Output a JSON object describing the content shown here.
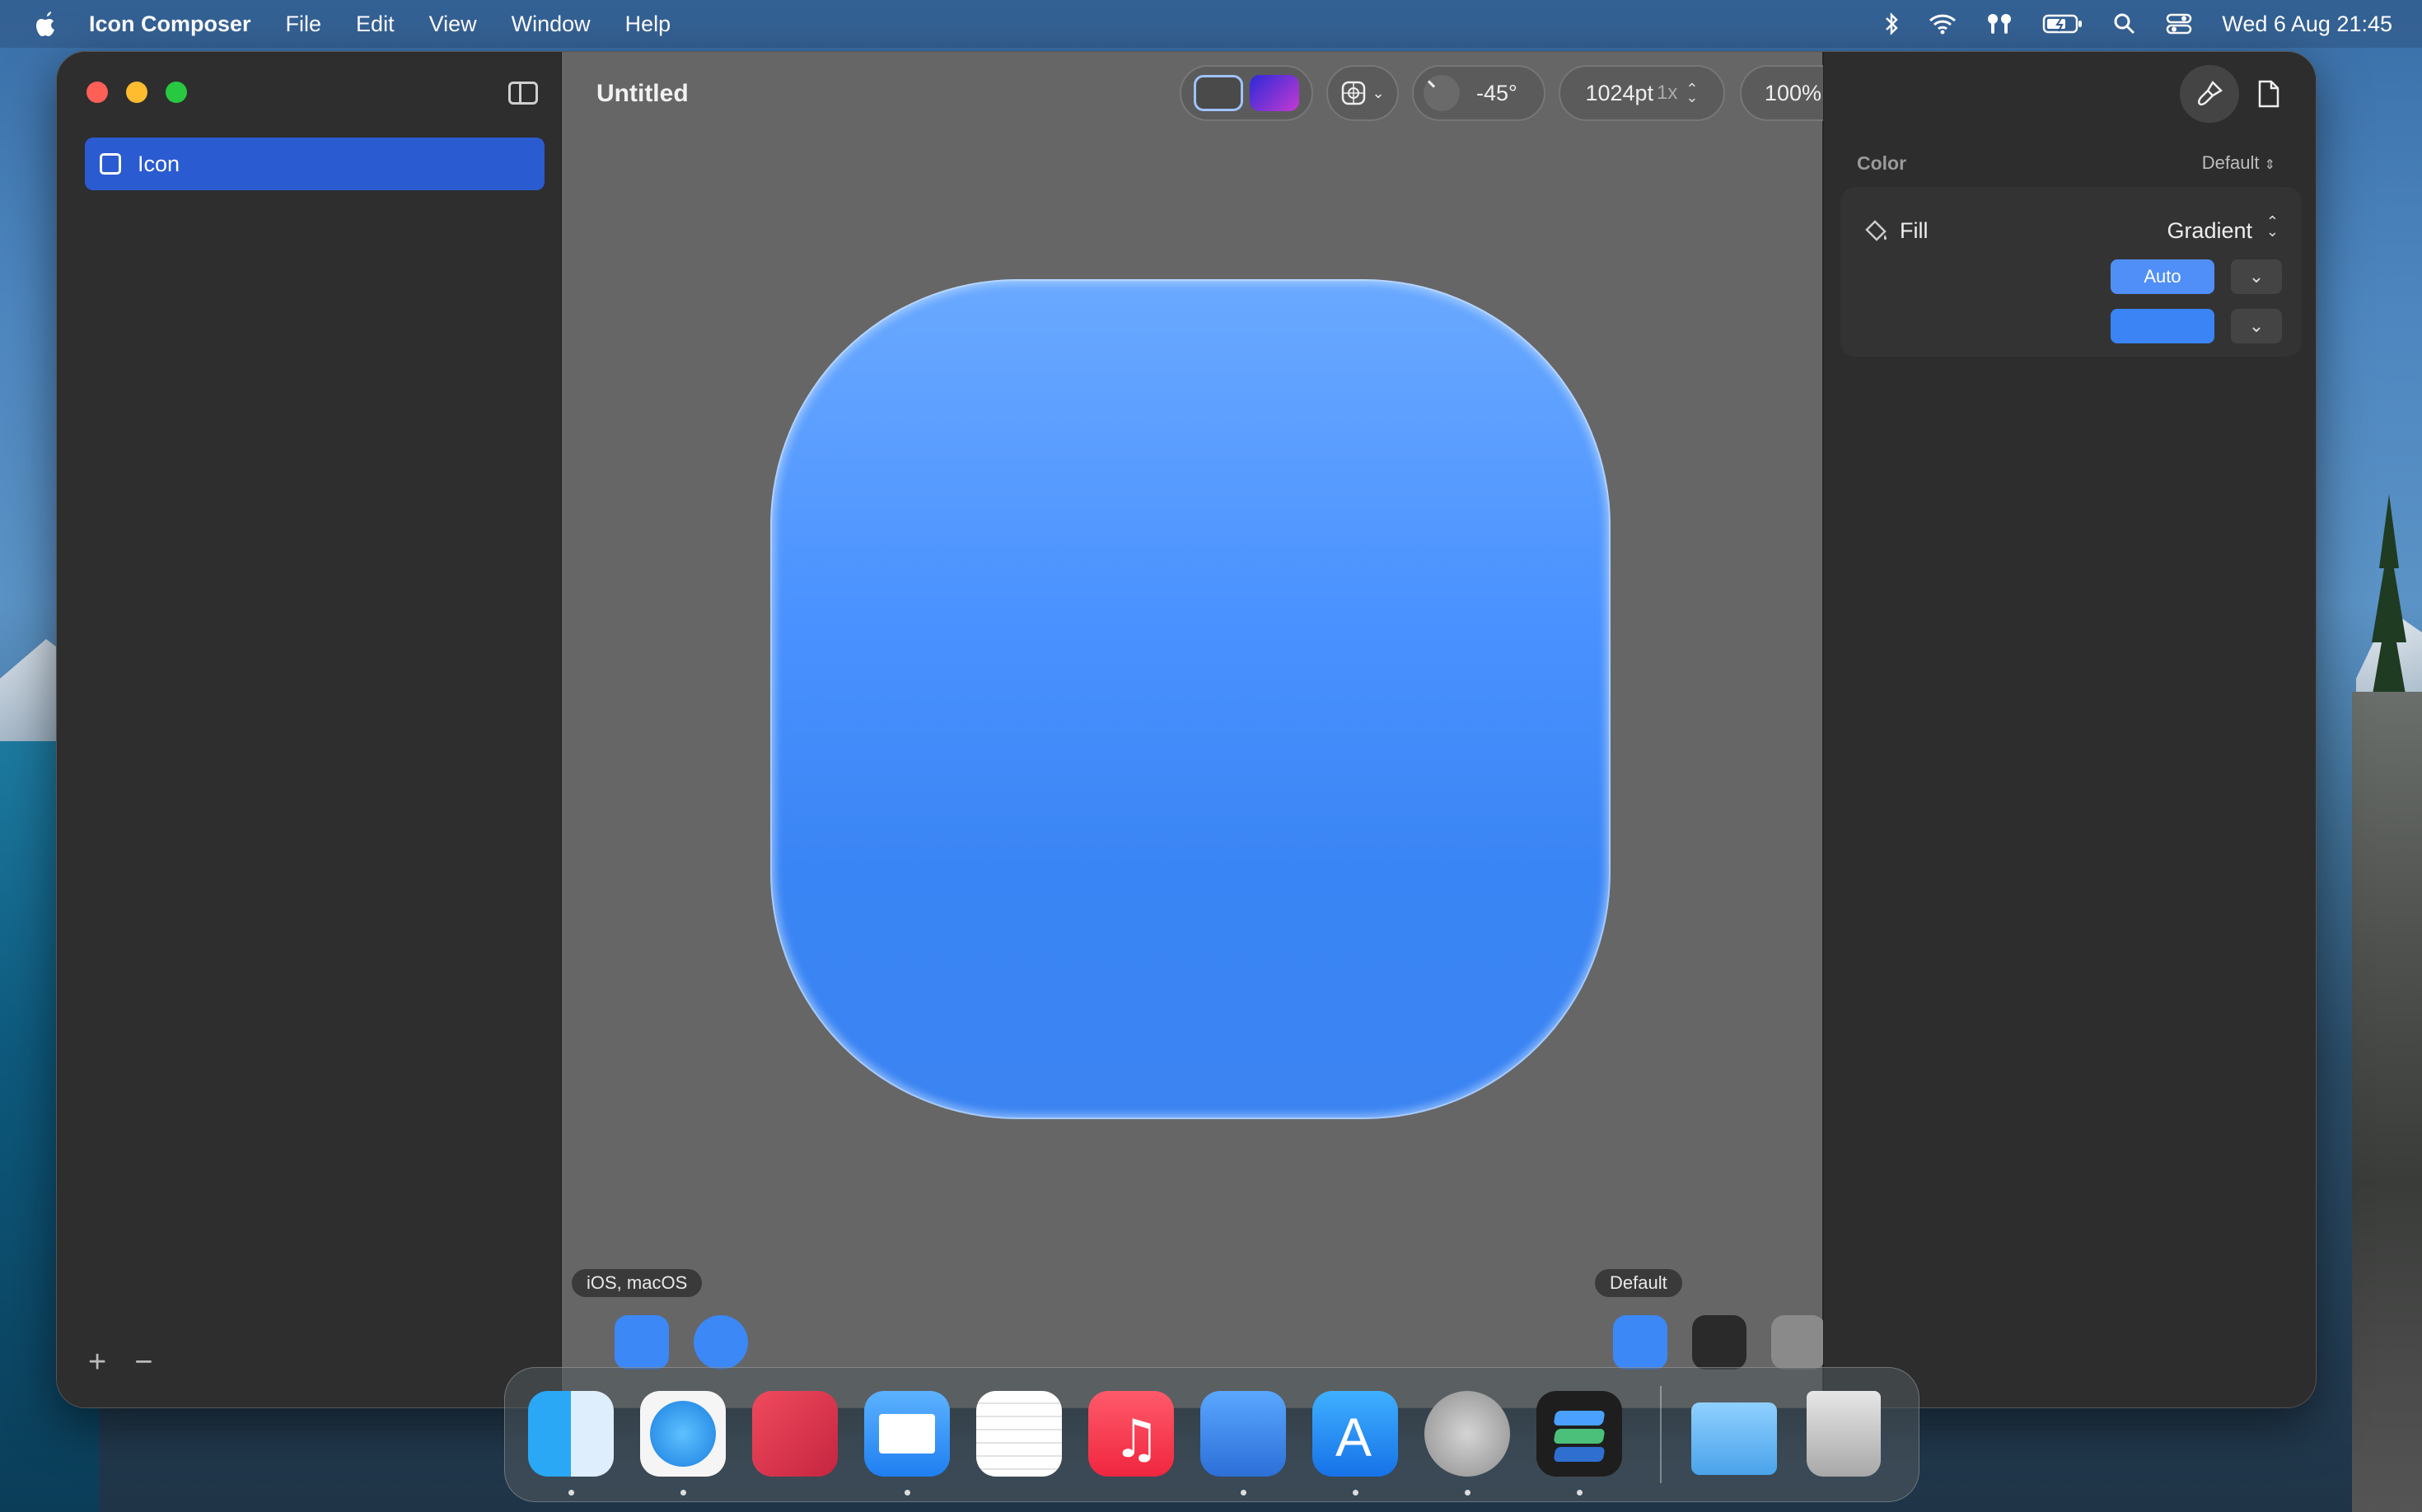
{
  "menubar": {
    "app_name": "Icon Composer",
    "items": [
      "File",
      "Edit",
      "View",
      "Window",
      "Help"
    ],
    "clock": "Wed 6 Aug  21:45"
  },
  "window": {
    "title": "Untitled",
    "sidebar": {
      "layer_label": "Icon",
      "add_label": "+",
      "remove_label": "−"
    },
    "toolbar": {
      "angle": "-45°",
      "size": "1024pt",
      "scale": "1x",
      "zoom": "100%"
    },
    "canvas": {
      "platform_label": "iOS, macOS",
      "appearance_label": "Default"
    },
    "inspector": {
      "section": "Color",
      "section_value": "Default",
      "fill_label": "Fill",
      "fill_value": "Gradient",
      "auto_label": "Auto",
      "chevron": "⌄"
    }
  },
  "colors": {
    "accent": "#2a5bd0",
    "icon_blue": "#3a85f5",
    "canvas_bg": "#666666"
  }
}
